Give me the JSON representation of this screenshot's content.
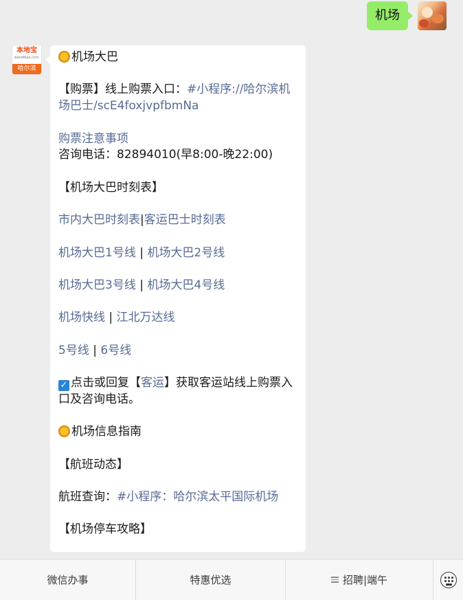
{
  "user_message": {
    "text": "机场"
  },
  "bot": {
    "avatar": {
      "brand": "本地宝",
      "site": "bendibao.com",
      "city": "哈尔滨"
    },
    "section1_title": "机场大巴",
    "ticket": {
      "prefix": "【购票】线上购票入口：",
      "link": "#小程序://哈尔滨机场巴士/scE4foxjvpfbmNa"
    },
    "notice_link": "购票注意事项",
    "phone": "咨询电话：82894010(早8:00-晚22:00)",
    "schedule_heading": "【机场大巴时刻表】",
    "schedule_links": {
      "a": "市内大巴时刻表",
      "sep": "|",
      "b": "客运巴士时刻表"
    },
    "line_links": [
      {
        "a": "机场大巴1号线",
        "sep": " | ",
        "b": "机场大巴2号线"
      },
      {
        "a": "机场大巴3号线",
        "sep": " | ",
        "b": "机场大巴4号线"
      },
      {
        "a": "机场快线",
        "sep": " | ",
        "b": "江北万达线"
      },
      {
        "a": "5号线",
        "sep": " | ",
        "b": "6号线"
      }
    ],
    "reply": {
      "pre": "点击或回复【",
      "keyword": "客运",
      "post": "】获取客运站线上购票入口及咨询电话。"
    },
    "section2_title": "机场信息指南",
    "flight_heading": "【航班动态】",
    "flight": {
      "prefix": "航班查询：",
      "link": "#小程序：哈尔滨太平国际机场"
    },
    "parking_heading": "【机场停车攻略】"
  },
  "menu": {
    "item1": "微信办事",
    "item2": "特惠优选",
    "item3": "招聘|端午"
  },
  "icons": [
    "sun-icon",
    "checkbox-icon",
    "menu-lines-icon",
    "keyboard-icon"
  ],
  "colors": {
    "link": "#576b95",
    "outgoing_bubble": "#95ec69",
    "background": "#ededed"
  }
}
